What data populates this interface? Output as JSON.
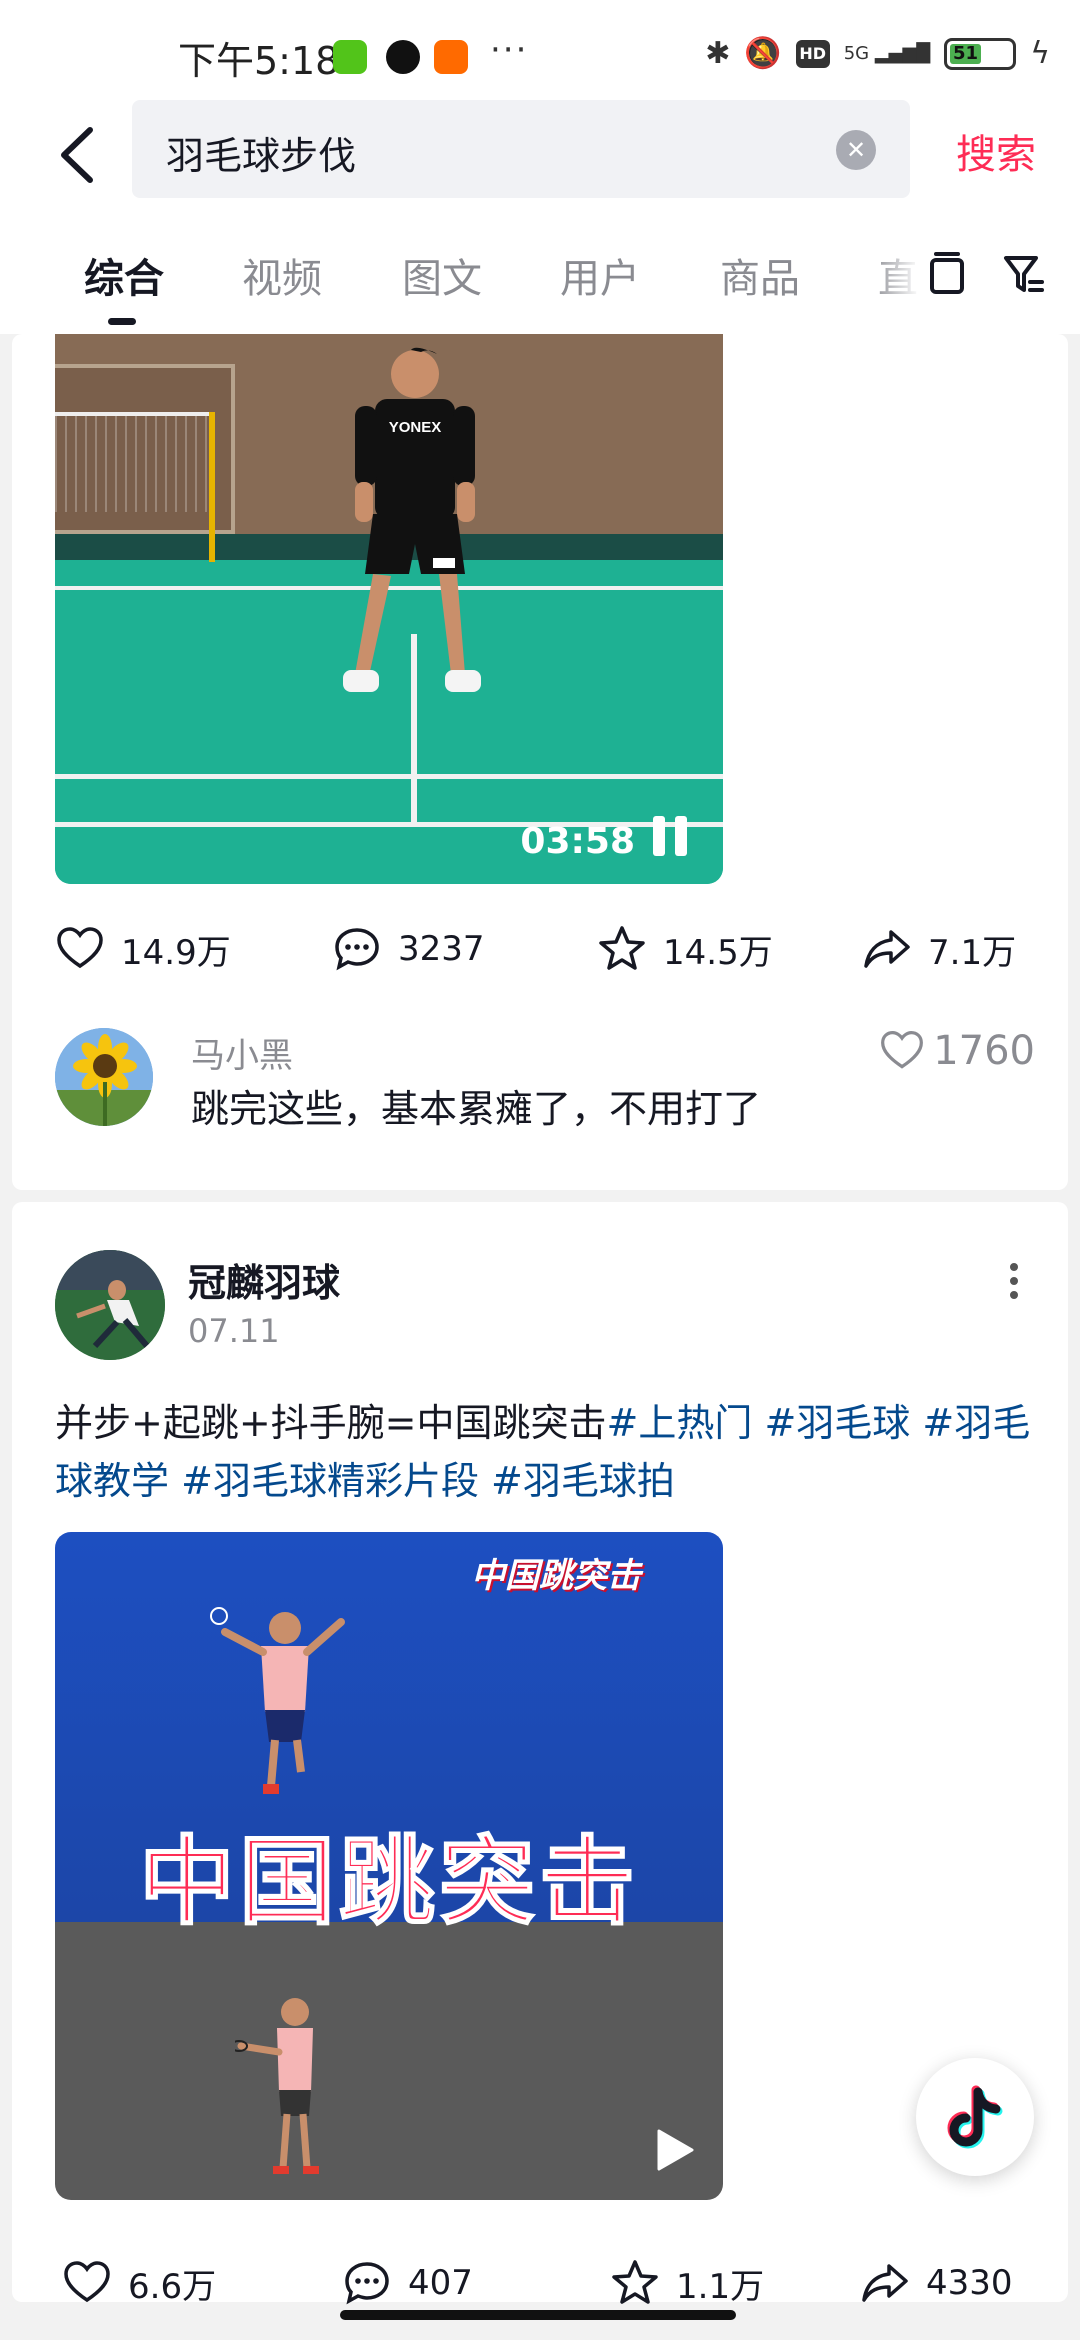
{
  "status_bar": {
    "time": "下午5:18",
    "more": "···",
    "network": "5G",
    "hd": "HD",
    "battery": "51"
  },
  "search": {
    "query": "羽毛球步伐",
    "submit_label": "搜索"
  },
  "tabs": [
    {
      "label": "综合",
      "active": true
    },
    {
      "label": "视频",
      "active": false
    },
    {
      "label": "图文",
      "active": false
    },
    {
      "label": "用户",
      "active": false
    },
    {
      "label": "商品",
      "active": false
    },
    {
      "label": "直",
      "active": false
    }
  ],
  "post1": {
    "video": {
      "duration": "03:58",
      "shirt_text": "YONEX",
      "state": "playing"
    },
    "actions": {
      "likes": "14.9万",
      "comments": "3237",
      "favorites": "14.5万",
      "shares": "7.1万"
    },
    "top_comment": {
      "author": "马小黑",
      "text": "跳完这些，基本累瘫了，不用打了",
      "likes": "1760"
    }
  },
  "post2": {
    "author": "冠麟羽球",
    "date": "07.11",
    "description": "并步+起跳+抖手腕=中国跳突击",
    "hashtags": [
      "#上热门",
      "#羽毛球",
      "#羽毛球教学",
      "#羽毛球精彩片段",
      "#羽毛球拍"
    ],
    "video": {
      "tag": "中国跳突击",
      "title": "中国跳突击",
      "state": "paused"
    },
    "actions": {
      "likes": "6.6万",
      "comments": "407",
      "favorites": "1.1万",
      "shares": "4330"
    }
  },
  "colors": {
    "accent": "#fe2c55",
    "hashtag": "#04498d",
    "court": "#1eb193"
  },
  "icons": [
    "back-icon",
    "clear-icon",
    "history-icon",
    "filter-icon",
    "heart-icon",
    "comment-icon",
    "star-icon",
    "share-icon",
    "more-icon",
    "play-icon",
    "pause-icon",
    "douyin-logo-icon"
  ]
}
